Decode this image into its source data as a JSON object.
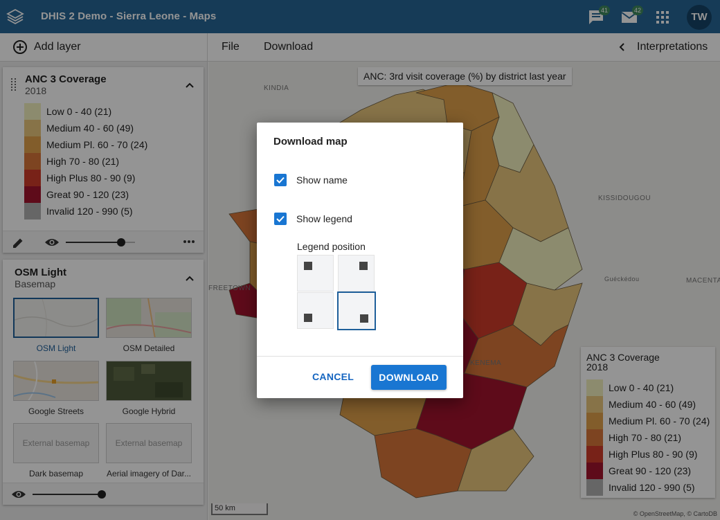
{
  "header": {
    "title": "DHIS 2 Demo - Sierra Leone - Maps",
    "messages_badge": "41",
    "mail_badge": "42",
    "avatar_initials": "TW",
    "bg_color": "#276696"
  },
  "toolbar": {
    "add_layer": "Add layer",
    "file": "File",
    "download": "Download",
    "interpretations": "Interpretations"
  },
  "thematic_layer": {
    "title": "ANC 3 Coverage",
    "period": "2018",
    "opacity": 0.8,
    "legend": [
      {
        "label": "Low 0 - 40 (21)",
        "color": "#f2efbe"
      },
      {
        "label": "Medium 40 - 60 (49)",
        "color": "#e8c77c"
      },
      {
        "label": "Medium Pl. 60 - 70 (24)",
        "color": "#e0a04a"
      },
      {
        "label": "High 70 - 80 (21)",
        "color": "#d8763a"
      },
      {
        "label": "High Plus 80 - 90 (9)",
        "color": "#cf3b2a"
      },
      {
        "label": "Great 90 - 120 (23)",
        "color": "#a3142e"
      },
      {
        "label": "Invalid 120 - 990 (5)",
        "color": "#b0b0b0"
      }
    ]
  },
  "basemap_layer": {
    "title": "OSM Light",
    "subtitle": "Basemap",
    "opacity": 1.0,
    "options": [
      {
        "label": "OSM Light",
        "selected": true
      },
      {
        "label": "OSM Detailed",
        "selected": false
      },
      {
        "label": "Google Streets",
        "selected": false
      },
      {
        "label": "Google Hybrid",
        "selected": false
      },
      {
        "label": "Dark basemap",
        "selected": false,
        "placeholder": "External basemap"
      },
      {
        "label": "Aerial imagery of Dar...",
        "selected": false,
        "placeholder": "External basemap"
      }
    ]
  },
  "map": {
    "title": "ANC: 3rd visit coverage (%) by district last year",
    "places": [
      "KINDIA",
      "KISSIDOUGOU",
      "Guéckédou",
      "MACENTA",
      "FREETOWN",
      "KENEMA"
    ],
    "scale": "50 km",
    "attribution": "© OpenStreetMap, © CartoDB",
    "legend_title": "ANC 3 Coverage",
    "legend_period": "2018"
  },
  "dialog": {
    "title": "Download map",
    "show_name": {
      "label": "Show name",
      "checked": true
    },
    "show_legend": {
      "label": "Show legend",
      "checked": true
    },
    "legend_position_label": "Legend position",
    "legend_position_selected": "bottom-right",
    "cancel": "CANCEL",
    "download": "DOWNLOAD"
  }
}
